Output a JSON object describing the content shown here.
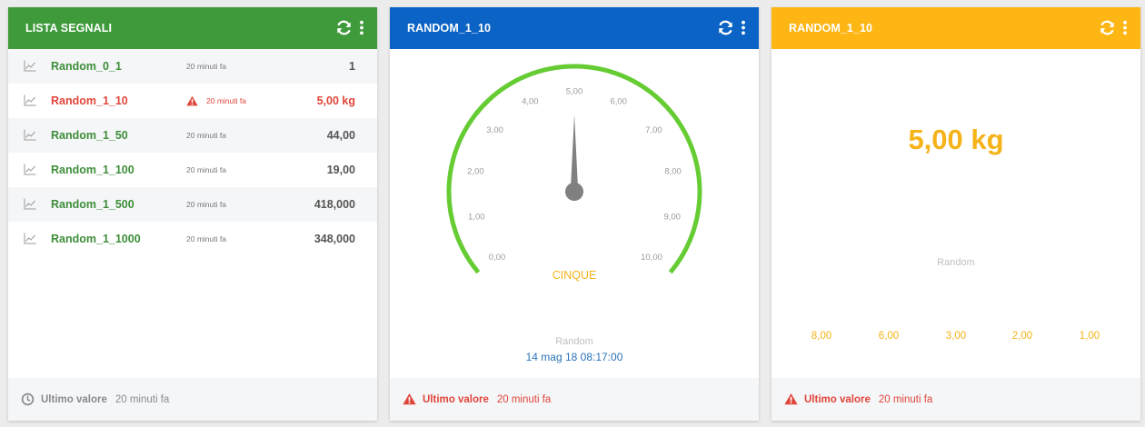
{
  "colors": {
    "green": "#3e9a3a",
    "blue": "#0b63c5",
    "yellow": "#fdb614",
    "alarm": "#e0453a",
    "gauge_arc": "#66cc33",
    "needle": "#808080",
    "value_yellow": "#f5b318"
  },
  "lista": {
    "title": "LISTA SEGNALI",
    "icons": {
      "refresh": "refresh-icon",
      "menu": "kebab-menu-icon"
    },
    "rows": [
      {
        "name": "Random_0_1",
        "time": "20 minuti fa",
        "value": "1",
        "alarm": false
      },
      {
        "name": "Random_1_10",
        "time": "20 minuti fa",
        "value": "5,00 kg",
        "alarm": true
      },
      {
        "name": "Random_1_50",
        "time": "20 minuti fa",
        "value": "44,00",
        "alarm": false
      },
      {
        "name": "Random_1_100",
        "time": "20 minuti fa",
        "value": "19,00",
        "alarm": false
      },
      {
        "name": "Random_1_500",
        "time": "20 minuti fa",
        "value": "418,000",
        "alarm": false
      },
      {
        "name": "Random_1_1000",
        "time": "20 minuti fa",
        "value": "348,000",
        "alarm": false
      }
    ],
    "footer": {
      "icon": "clock-icon",
      "label": "Ultimo valore",
      "time": "20 minuti fa"
    }
  },
  "gauge_card": {
    "title": "RANDOM_1_10",
    "gauge": {
      "min": 0,
      "max": 10,
      "value": 5,
      "ticks": [
        "0,00",
        "1,00",
        "2,00",
        "3,00",
        "4,00",
        "5,00",
        "6,00",
        "7,00",
        "8,00",
        "9,00",
        "10,00"
      ],
      "value_text": "CINQUE"
    },
    "signal_name": "Random",
    "timestamp": "14 mag 18 08:17:00",
    "footer": {
      "icon": "warning-icon",
      "label": "Ultimo valore",
      "time": "20 minuti fa"
    }
  },
  "value_card": {
    "title": "RANDOM_1_10",
    "value": "5,00 kg",
    "signal_name": "Random",
    "scale": [
      "8,00",
      "6,00",
      "3,00",
      "2,00",
      "1,00"
    ],
    "footer": {
      "icon": "warning-icon",
      "label": "Ultimo valore",
      "time": "20 minuti fa"
    }
  }
}
